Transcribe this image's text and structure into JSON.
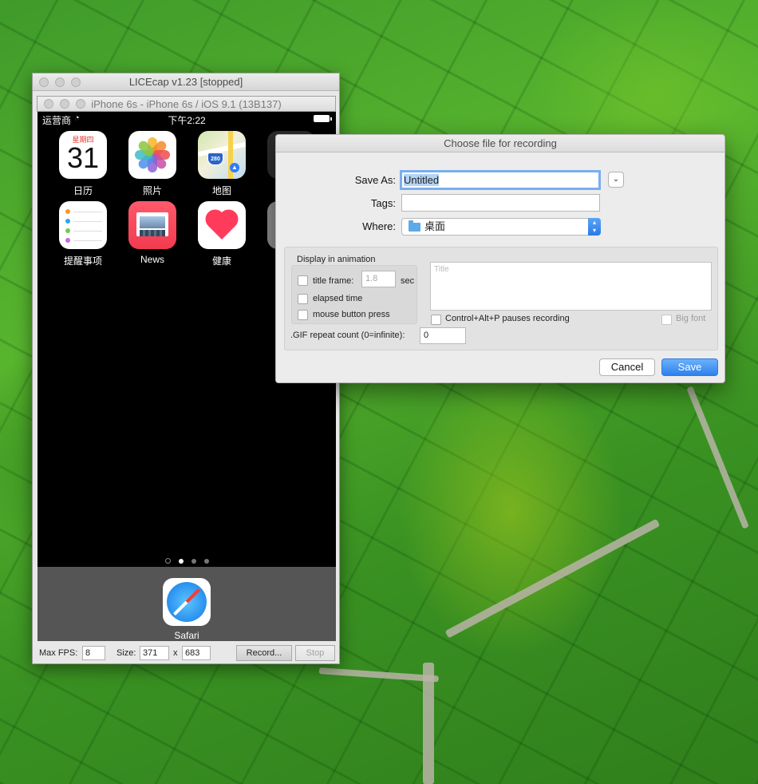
{
  "licecap": {
    "window_title": "LICEcap v1.23 [stopped]",
    "max_fps_label": "Max FPS:",
    "max_fps_value": "8",
    "size_label": "Size:",
    "width_value": "371",
    "times_label": "x",
    "height_value": "683",
    "record_label": "Record...",
    "stop_label": "Stop"
  },
  "simulator": {
    "title": "iPhone 6s - iPhone 6s / iOS 9.1 (13B137)",
    "status": {
      "carrier": "运营商",
      "time": "下午2:22"
    },
    "apps": [
      {
        "label": "日历",
        "icon": "calendar-icon",
        "day": "星期四",
        "date": "31"
      },
      {
        "label": "照片",
        "icon": "photos-icon"
      },
      {
        "label": "地图",
        "icon": "maps-icon",
        "shield": "280"
      },
      {
        "label": "提醒事项",
        "icon": "reminders-icon"
      },
      {
        "label": "News",
        "icon": "news-icon"
      },
      {
        "label": "健康",
        "icon": "health-icon"
      }
    ],
    "dock_app": {
      "label": "Safari",
      "icon": "safari-compass-icon"
    }
  },
  "dialog": {
    "title": "Choose file for recording",
    "save_as_label": "Save As:",
    "save_as_value": "Untitled",
    "tags_label": "Tags:",
    "tags_value": "",
    "where_label": "Where:",
    "where_value": "桌面",
    "display_group_title": "Display in animation",
    "title_frame_label": "title frame:",
    "title_frame_value": "1.8",
    "sec_label": "sec",
    "elapsed_time_label": "elapsed time",
    "mouse_button_label": "mouse button press",
    "title_placeholder": "Title",
    "pause_label": "Control+Alt+P pauses recording",
    "big_font_label": "Big font",
    "gif_repeat_label": ".GIF repeat count (0=infinite):",
    "gif_repeat_value": "0",
    "cancel_label": "Cancel",
    "save_label": "Save",
    "accent_color": "#2e80ee"
  }
}
